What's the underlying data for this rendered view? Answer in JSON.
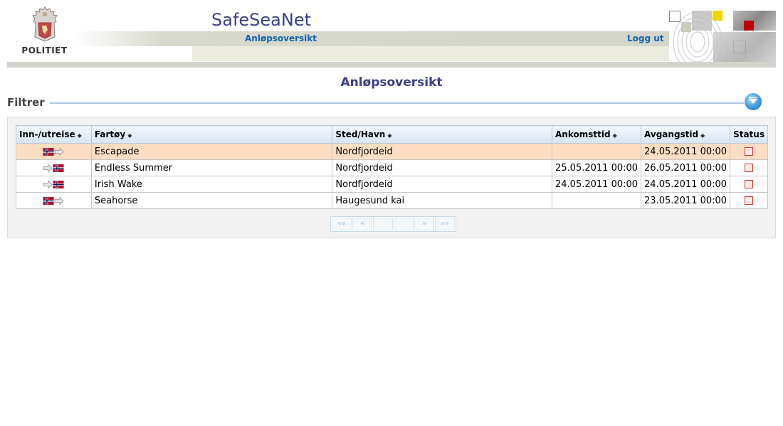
{
  "header": {
    "logo_text": "POLITIET",
    "app_title": "SafeSeaNet",
    "nav_link": "Anløpsoversikt",
    "logout_link": "Logg ut"
  },
  "page": {
    "heading": "Anløpsoversikt",
    "filter_label": "Filtrer"
  },
  "table": {
    "columns": [
      "Inn-/utreise",
      "Fartøy",
      "Sted/Havn",
      "Ankomsttid",
      "Avgangstid",
      "Status"
    ],
    "rows": [
      {
        "direction": "out",
        "vessel": "Escapade",
        "place": "Nordfjordeid",
        "arrival": "",
        "departure": "24.05.2011 00:00",
        "selected": true
      },
      {
        "direction": "in",
        "vessel": "Endless Summer",
        "place": "Nordfjordeid",
        "arrival": "25.05.2011 00:00",
        "departure": "26.05.2011 00:00",
        "selected": false
      },
      {
        "direction": "in",
        "vessel": "Irish Wake",
        "place": "Nordfjordeid",
        "arrival": "24.05.2011 00:00",
        "departure": "24.05.2011 00:00",
        "selected": false
      },
      {
        "direction": "out",
        "vessel": "Seahorse",
        "place": "Haugesund kai",
        "arrival": "",
        "departure": "23.05.2011 00:00",
        "selected": false
      }
    ]
  },
  "pager": {
    "first": "««",
    "prev": "«",
    "next": "»",
    "last": "»»"
  },
  "icons": {
    "sort": "sort-icon",
    "flag": "norway-flag-icon",
    "arrow": "arrow-right-icon",
    "status": "status-checkbox-icon",
    "filter_toggle": "expand-filter-icon"
  },
  "colors": {
    "title": "#3a3f8a",
    "link": "#1664b0",
    "selected_row": "#fddec2",
    "status_box": "#d03030"
  }
}
